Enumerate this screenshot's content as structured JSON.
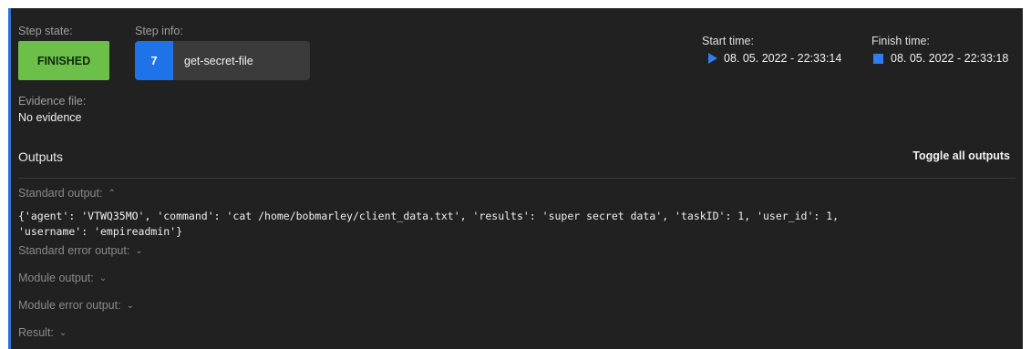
{
  "step": {
    "state_label": "Step state:",
    "state_value": "FINISHED",
    "info_label": "Step info:",
    "number": "7",
    "name": "get-secret-file"
  },
  "times": {
    "start_label": "Start time:",
    "start_value": "08. 05. 2022 - 22:33:14",
    "finish_label": "Finish time:",
    "finish_value": "08. 05. 2022 - 22:33:18"
  },
  "evidence": {
    "label": "Evidence file:",
    "value": "No evidence"
  },
  "outputs": {
    "title": "Outputs",
    "toggle_label": "Toggle all outputs",
    "standard_output_label": "Standard output:",
    "standard_output_text": "{'agent': 'VTWQ35MO', 'command': 'cat /home/bobmarley/client_data.txt', 'results': 'super secret data', 'taskID': 1, 'user_id': 1,\n'username': 'empireadmin'}",
    "standard_error_label": "Standard error output:",
    "module_output_label": "Module output:",
    "module_error_label": "Module error output:",
    "result_label": "Result:"
  },
  "colors": {
    "panel_bg": "#212121",
    "finished_green": "#6cc04a",
    "accent_blue": "#1e73e8"
  },
  "icons": {
    "start": "play-icon",
    "finish": "stop-icon",
    "expanded": "chevron-up-icon",
    "collapsed": "chevron-down-icon"
  }
}
